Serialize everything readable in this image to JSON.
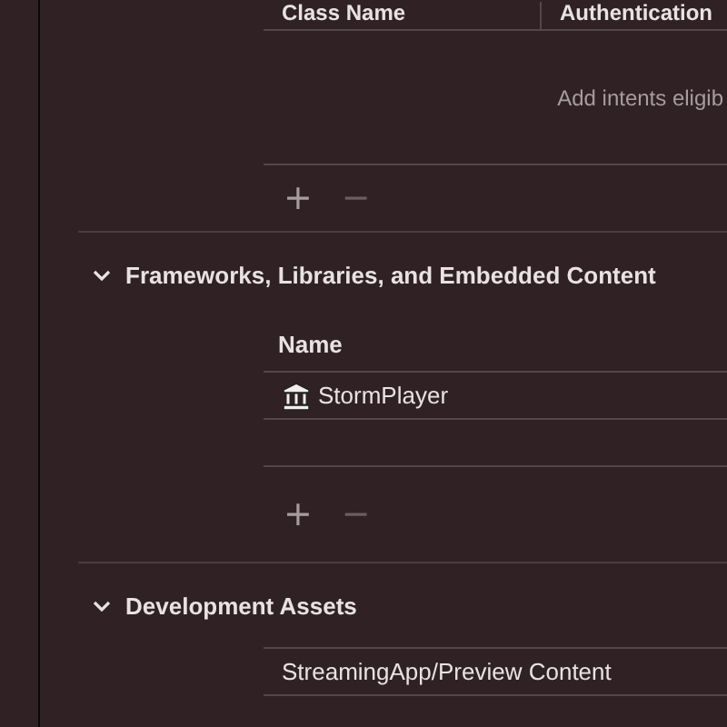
{
  "intents_table": {
    "columns": [
      "Class Name",
      "Authentication"
    ],
    "empty_hint": "Add intents eligib",
    "add_label": "+",
    "remove_label": "−"
  },
  "sections": [
    {
      "title": "Frameworks, Libraries, and Embedded Content",
      "expanded": true,
      "kind": "table",
      "header": "Name",
      "rows": [
        {
          "name": "StormPlayer",
          "kind": "framework"
        },
        {
          "name": "",
          "kind": "blank"
        }
      ],
      "add_label": "+",
      "remove_label": "−"
    },
    {
      "title": "Development Assets",
      "expanded": true,
      "kind": "list",
      "rows": [
        {
          "name": "StreamingApp/Preview Content"
        }
      ]
    }
  ]
}
